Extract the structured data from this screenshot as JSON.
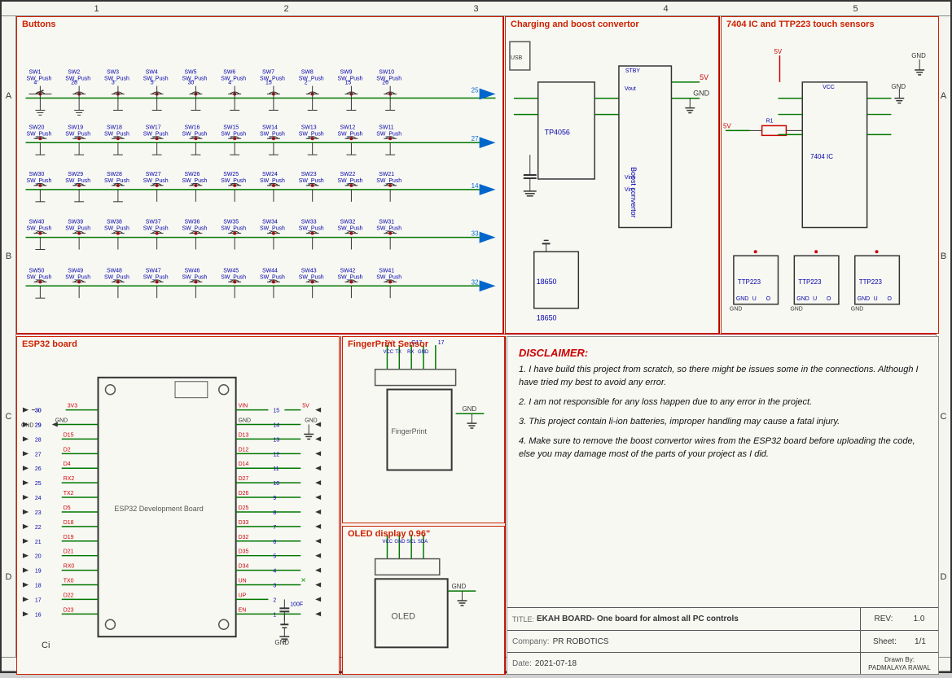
{
  "sheet": {
    "title": "EKAH BOARD- One board for almost all PC controls",
    "company": "PR ROBOTICS",
    "date": "2021-07-18",
    "drawn_by": "PADMALAYA RAWAL",
    "rev": "1.0",
    "sheet": "1/1"
  },
  "grid": {
    "columns": [
      "1",
      "2",
      "3",
      "4",
      "5"
    ],
    "rows": [
      "A",
      "B",
      "C",
      "D"
    ]
  },
  "panels": {
    "buttons": {
      "title": "Buttons"
    },
    "charging": {
      "title": "Charging and boost convertor"
    },
    "ic7404": {
      "title": "7404 IC and TTP223 touch sensors"
    },
    "esp32": {
      "title": "ESP32 board"
    },
    "fingerprint": {
      "title": "FingerPrint Sensor"
    },
    "oled": {
      "title": "OLED display 0.96\""
    }
  },
  "disclaimer": {
    "title": "DISCLAIMER:",
    "items": [
      "1. I have build this project from scratch, so there might be issues some in the connections. Although I have tried my best to avoid any error.",
      "2. I am not responsible for any loss happen due to any error in the project.",
      "3. This project contain li-ion batteries, improper handling may cause a fatal injury.",
      "4. Make sure to remove the boost convertor wires from the ESP32 board before uploading the code, else you may damage most of the parts of your project as I did."
    ]
  },
  "title_block": {
    "title_label": "TITLE:",
    "title_value": "EKAH BOARD- One board for almost all PC controls",
    "rev_label": "REV:",
    "rev_value": "1.0",
    "company_label": "Company:",
    "company_value": "PR ROBOTICS",
    "sheet_label": "Sheet:",
    "sheet_value": "1/1",
    "date_label": "Date:",
    "date_value": "2021-07-18",
    "drawn_label": "Drawn By:",
    "drawn_value": "PADMALAYA RAWAL"
  }
}
